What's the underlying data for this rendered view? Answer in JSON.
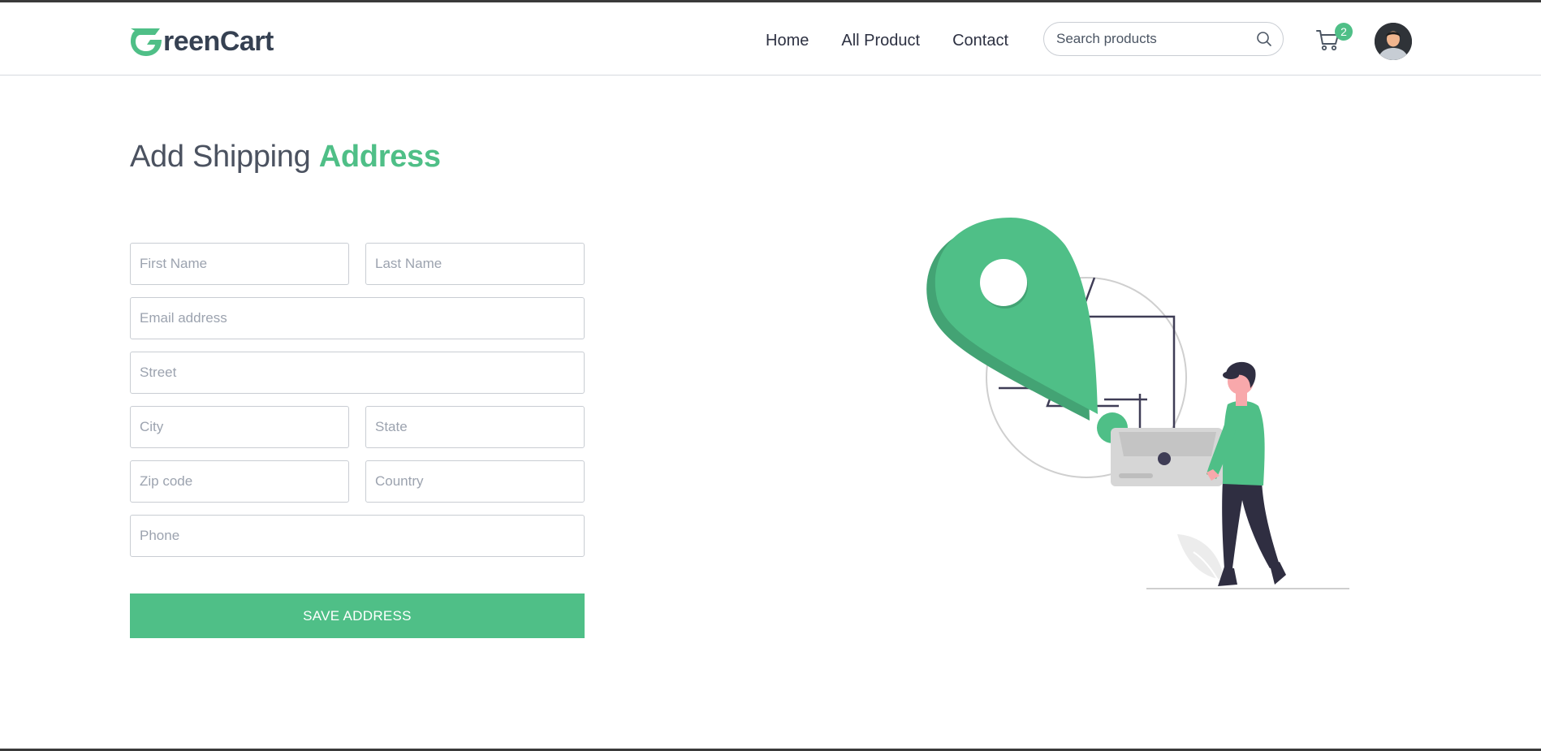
{
  "brand": {
    "name": "reenCart",
    "logo_letter": "G",
    "accent": "#4fbf87",
    "text_color": "#364152"
  },
  "nav": {
    "items": [
      {
        "label": "Home"
      },
      {
        "label": "All Product"
      },
      {
        "label": "Contact"
      }
    ]
  },
  "search": {
    "placeholder": "Search products",
    "icon": "search-icon"
  },
  "cart": {
    "count": "2",
    "icon": "cart-icon"
  },
  "page": {
    "title_plain": "Add Shipping ",
    "title_accent": "Address"
  },
  "form": {
    "first_name_placeholder": "First Name",
    "last_name_placeholder": "Last Name",
    "email_placeholder": "Email address",
    "street_placeholder": "Street",
    "city_placeholder": "City",
    "state_placeholder": "State",
    "zip_placeholder": "Zip code",
    "country_placeholder": "Country",
    "phone_placeholder": "Phone",
    "save_label": "SAVE ADDRESS"
  },
  "colors": {
    "accent": "#4fbf87",
    "dark": "#2f2e41",
    "grey": "#d0d0d0"
  }
}
